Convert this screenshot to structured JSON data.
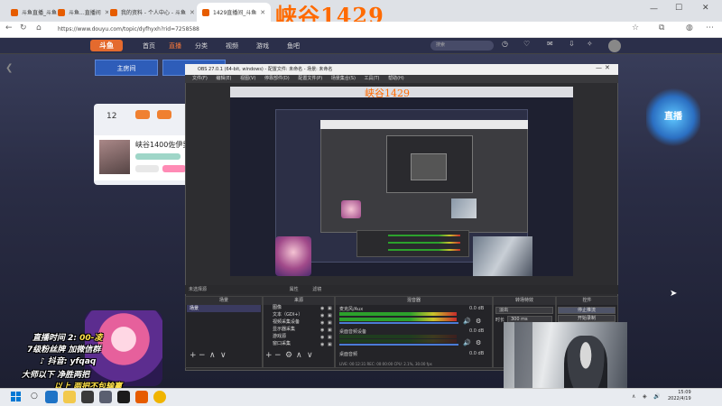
{
  "browser": {
    "tabs": [
      {
        "label": "斗鱼直播_斗鱼 - 每个人的直播平台"
      },
      {
        "label": "斗鱼...直播间"
      },
      {
        "label": "我的资料 - 个人中心 - 斗鱼"
      },
      {
        "label": "1429直播间_斗鱼"
      }
    ],
    "watermark": "峡谷1429",
    "url": "https://www.douyu.com/topic/dyfhyxh?rid=7258588"
  },
  "site": {
    "logo": "斗鱼",
    "nav": [
      "首页",
      "直播",
      "分类",
      "视频",
      "游戏",
      "鱼吧"
    ],
    "search_placeholder": "搜索",
    "header_buttons": [
      "主房间"
    ],
    "card_count": "12",
    "streamer_name": "峡谷1400佐伊男",
    "side_logo": "直播"
  },
  "obs": {
    "title": "OBS 27.0.1 (64-bit, windows) - 配置文件: 未命名 - 场景: 未命名",
    "menu": [
      "文件(F)",
      "编辑(E)",
      "视图(V)",
      "停靠部件(D)",
      "配置文件(P)",
      "场景集合(S)",
      "工具(T)",
      "帮助(H)"
    ],
    "preview_watermark": "峡谷1429",
    "docks_header": "未选择源",
    "docks_tabs": [
      "属性",
      "滤镜"
    ],
    "panels": {
      "scenes": "场景",
      "sources": "来源",
      "mixer": "混音器",
      "transitions": "转场特效",
      "controls": "控件"
    },
    "scene_items": [
      "场景"
    ],
    "source_items": [
      "图像",
      "文本（GDI+）",
      "视频采集设备",
      "显示器采集",
      "游戏源",
      "窗口采集"
    ],
    "mixer_channels": [
      {
        "name": "麦克风/Aux",
        "db": "0.0 dB"
      },
      {
        "name": "桌面音频设备",
        "db": "0.0 dB"
      },
      {
        "name": "桌面音频",
        "db": "0.0 dB"
      }
    ],
    "transition_value": "淡出",
    "duration_label": "时长",
    "duration_value": "300 ms",
    "control_buttons": [
      "停止推流",
      "开始录制",
      "启动虚拟摄像机",
      "工作室模式",
      "设置",
      "退出"
    ],
    "status": "LIVE: 00:12:31  REC: 00:00:00  CPU: 2.1%, 30.00 fps",
    "toolbar": [
      "+",
      "−",
      "∧",
      "∨"
    ]
  },
  "overlay": {
    "line1_a": "直播时间 2:",
    "line1_b": "00-凌",
    "line2": "7级粉丝牌 加微信群",
    "line3": "♪ 抖音: yfqaq",
    "line4": "大师以下 净胜两把",
    "line5": "以上 两把不包输赢"
  },
  "taskbar": {
    "clock_time": "15:09",
    "clock_date": "2022/4/19"
  }
}
